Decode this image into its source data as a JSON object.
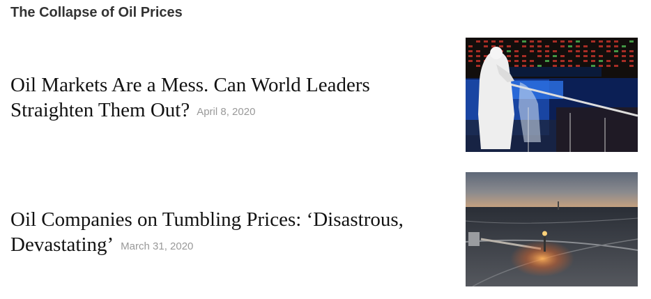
{
  "section": {
    "title": "The Collapse of Oil Prices"
  },
  "stories": [
    {
      "headline_line1": "Oil Markets Are a Mess. Can World Leaders",
      "headline_line2": "Straighten Them Out?",
      "date": "April 8, 2020",
      "image": "stock-exchange-trader-photo"
    },
    {
      "headline_line1": "Oil Companies on Tumbling Prices: ‘Disastrous,",
      "headline_line2": "Devastating’",
      "date": "March 31, 2020",
      "image": "oil-field-flare-photo"
    }
  ],
  "colors": {
    "headline": "#121212",
    "section_title": "#333333",
    "date": "#999999"
  }
}
